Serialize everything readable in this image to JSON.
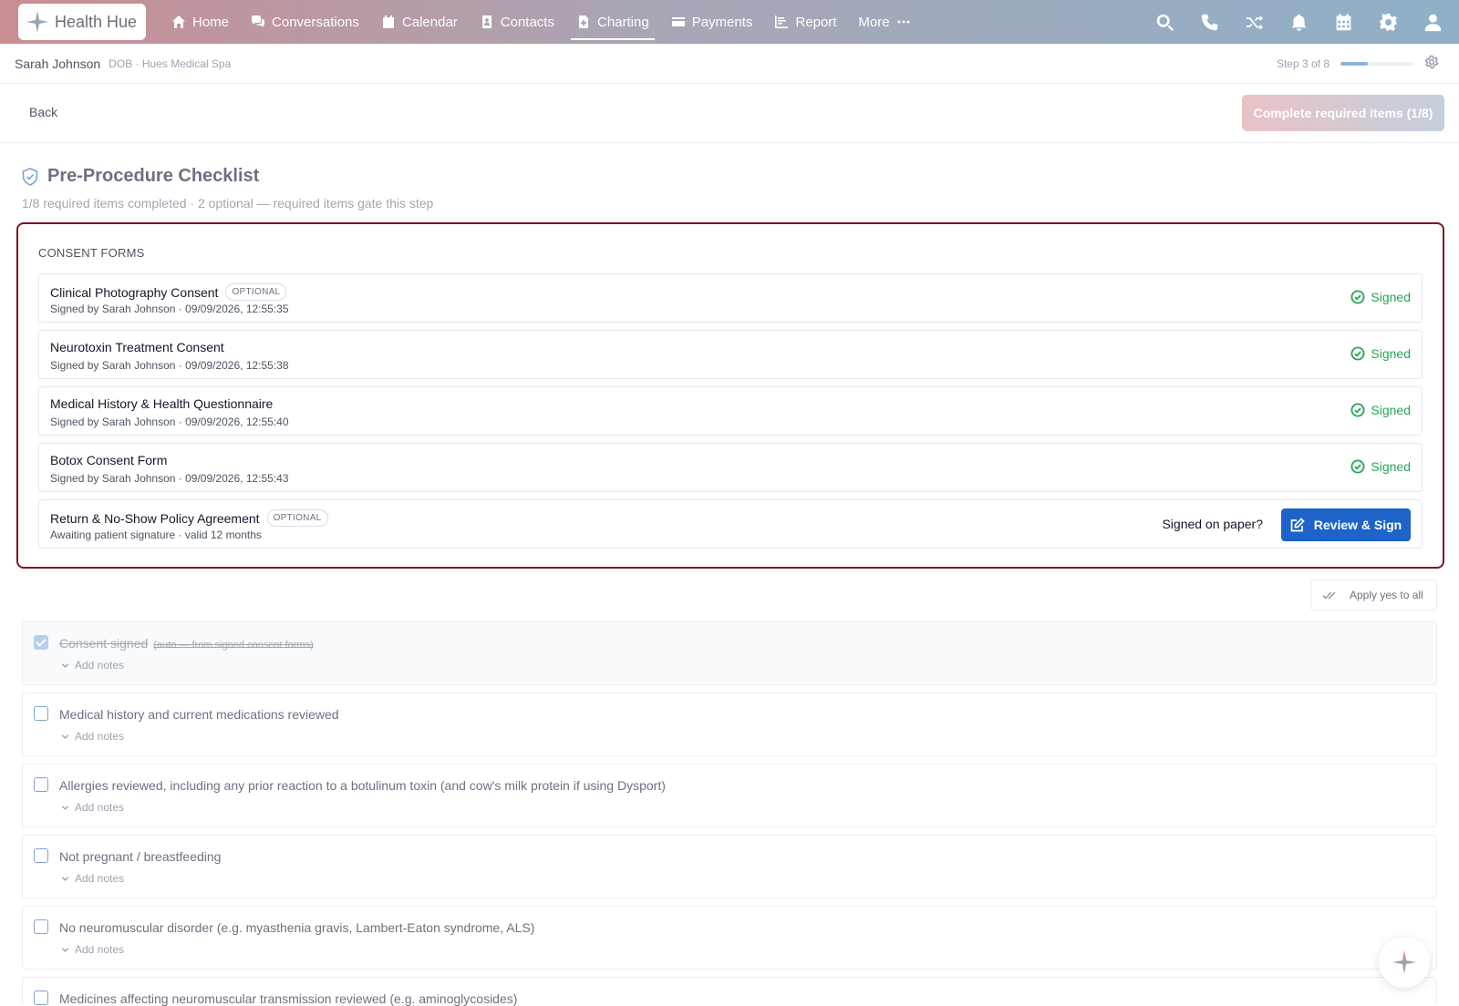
{
  "brand": {
    "name": "Health Hue"
  },
  "nav": {
    "items": [
      {
        "label": "Home",
        "icon": "home-icon"
      },
      {
        "label": "Conversations",
        "icon": "chat-icon"
      },
      {
        "label": "Calendar",
        "icon": "calendar-icon"
      },
      {
        "label": "Contacts",
        "icon": "contact-icon"
      },
      {
        "label": "Charting",
        "icon": "document-icon",
        "active": true
      },
      {
        "label": "Payments",
        "icon": "card-icon"
      },
      {
        "label": "Report",
        "icon": "chart-icon"
      },
      {
        "label": "More",
        "icon": "more-icon"
      }
    ],
    "right_icons": [
      "search-icon",
      "phone-icon",
      "shuffle-icon",
      "bell-icon",
      "calendar-grid-icon",
      "gear-icon",
      "user-icon"
    ]
  },
  "patient": {
    "name": "Sarah Johnson",
    "meta": "DOB · Hues Medical Spa",
    "step": "Step 3 of 8",
    "step_progress": 0.375
  },
  "actions": {
    "back_label": "Back",
    "complete_label": "Complete required items (1/8)"
  },
  "checklist": {
    "title": "Pre-Procedure Checklist",
    "subtitle": "1/8 required items completed · 2 optional — required items gate this step",
    "apply_label": "Apply yes to all",
    "add_notes_label": "Add notes",
    "items": [
      {
        "label": "Consent signed",
        "note": "(auto — from signed consent forms)",
        "checked": true
      },
      {
        "label": "Medical history and current medications reviewed",
        "checked": false
      },
      {
        "label": "Allergies reviewed, including any prior reaction to a botulinum toxin (and cow's milk protein if using Dysport)",
        "checked": false
      },
      {
        "label": "Not pregnant / breastfeeding",
        "checked": false
      },
      {
        "label": "No neuromuscular disorder (e.g. myasthenia gravis, Lambert-Eaton syndrome, ALS)",
        "checked": false
      },
      {
        "label": "Medicines affecting neuromuscular transmission reviewed (e.g. aminoglycosides)",
        "checked": false
      }
    ]
  },
  "consent": {
    "heading": "CONSENT FORMS",
    "optional_badge": "OPTIONAL",
    "signed_label": "Signed",
    "paper_question": "Signed on paper?",
    "review_label": "Review & Sign",
    "forms": [
      {
        "title": "Clinical Photography Consent",
        "optional": true,
        "sub": "Signed by Sarah Johnson · 09/09/2026, 12:55:35",
        "status": "signed"
      },
      {
        "title": "Neurotoxin Treatment Consent",
        "optional": false,
        "sub": "Signed by Sarah Johnson · 09/09/2026, 12:55:38",
        "status": "signed"
      },
      {
        "title": "Medical History & Health Questionnaire",
        "optional": false,
        "sub": "Signed by Sarah Johnson · 09/09/2026, 12:55:40",
        "status": "signed"
      },
      {
        "title": "Botox Consent Form",
        "optional": false,
        "sub": "Signed by Sarah Johnson · 09/09/2026, 12:55:43",
        "status": "signed"
      },
      {
        "title": "Return & No-Show Policy Agreement",
        "optional": true,
        "sub": "Awaiting patient signature · valid 12 months",
        "status": "pending"
      }
    ]
  },
  "colors": {
    "accent": "#1d63c9",
    "signed": "#22a652",
    "highlight_border": "#7a1620"
  }
}
